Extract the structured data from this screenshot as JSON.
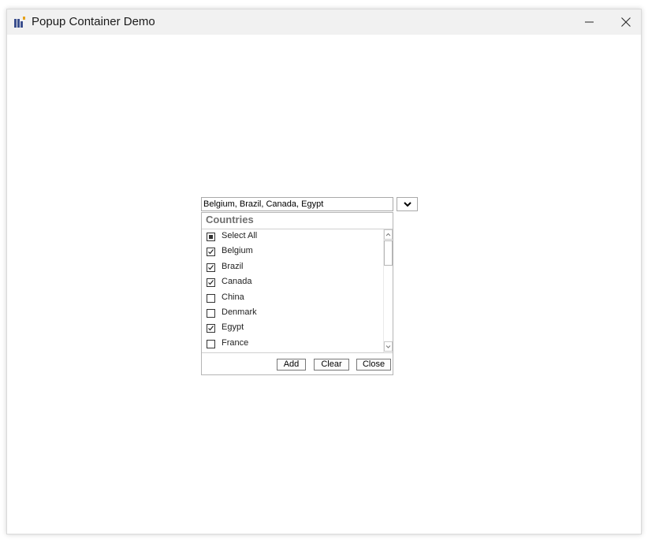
{
  "window": {
    "title": "Popup Container Demo",
    "icon": "app-grid-icon",
    "minimize_icon": "minimize-icon",
    "close_icon": "close-icon"
  },
  "combo": {
    "value": "Belgium, Brazil, Canada, Egypt",
    "dropdown_icon": "chevron-down-icon"
  },
  "popup": {
    "header": "Countries",
    "items": [
      {
        "label": "Select All",
        "state": "indeterminate"
      },
      {
        "label": "Belgium",
        "state": "checked"
      },
      {
        "label": "Brazil",
        "state": "checked"
      },
      {
        "label": "Canada",
        "state": "checked"
      },
      {
        "label": "China",
        "state": "unchecked"
      },
      {
        "label": "Denmark",
        "state": "unchecked"
      },
      {
        "label": "Egypt",
        "state": "checked"
      },
      {
        "label": "France",
        "state": "unchecked"
      }
    ],
    "buttons": {
      "add": "Add",
      "clear": "Clear",
      "close": "Close"
    }
  }
}
